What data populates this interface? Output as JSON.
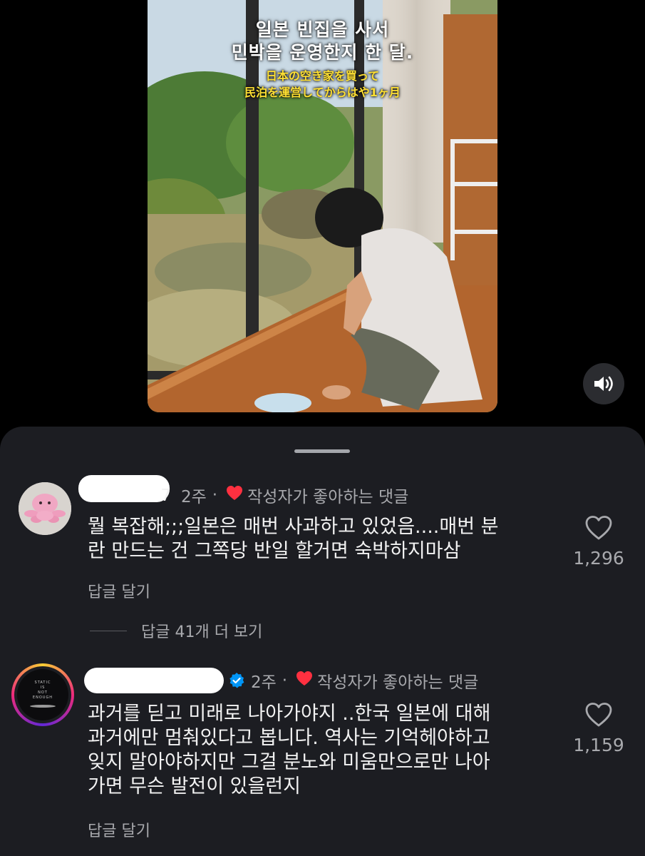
{
  "video": {
    "caption_ko": [
      "일본 빈집을 사서",
      "민박을 운영한지 한 달."
    ],
    "caption_jp": [
      "日本の空き家を買って",
      "民泊を運営してからはや1ヶ月"
    ],
    "sound_icon": "speaker-icon"
  },
  "comments": [
    {
      "username_partial": "7",
      "time": "2주",
      "separator": "·",
      "badge": "작성자가 좋아하는 댓글",
      "verified": false,
      "text_lines": [
        "뭘 복잡해;;;일본은 매번 사과하고 있었음....매번 분",
        "란 만드는 건 그쪽당 반일 할거면 숙박하지마삼"
      ],
      "reply_label": "답글 달기",
      "likes": "1,296",
      "more_replies": "답글 41개 더 보기"
    },
    {
      "time": "2주",
      "separator": "·",
      "badge": "작성자가 좋아하는 댓글",
      "verified": true,
      "text_lines": [
        "과거를 딛고 미래로 나아가야지 ..한국 일본에 대해",
        "과거에만 멈춰있다고 봅니다. 역사는 기억헤야하고",
        "잊지 말아야하지만 그걸 분노와 미움만으로만 나아",
        "가면 무슨 발전이 있을런지"
      ],
      "reply_label": "답글 달기",
      "likes": "1,159",
      "avatar_text": [
        "STATIC",
        "IS",
        "NOT",
        "ENOUGH"
      ]
    }
  ],
  "colors": {
    "sheet_bg": "#1c1d22",
    "heart_red": "#ff3040",
    "verified_blue": "#0095f6",
    "muted": "#a8a9ad"
  }
}
